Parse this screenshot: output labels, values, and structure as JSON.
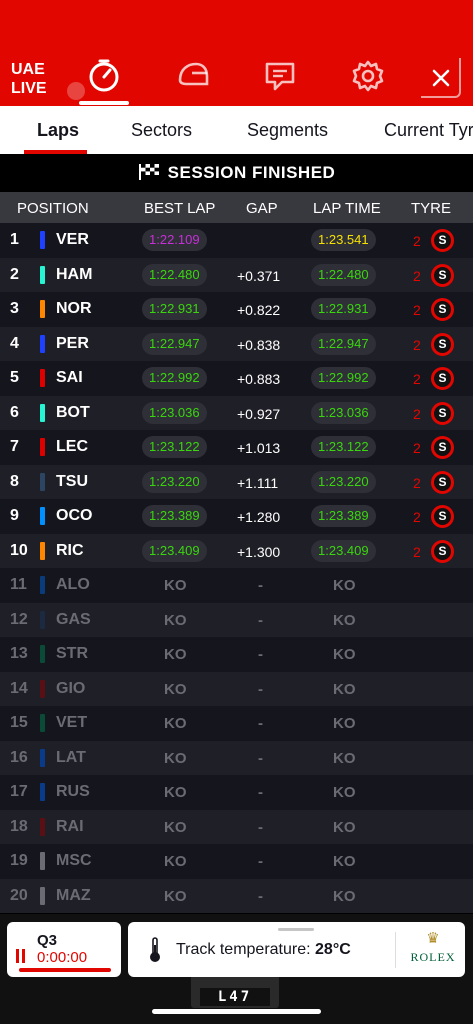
{
  "header": {
    "event_code": "UAE",
    "live_label": "LIVE",
    "icons": [
      "timing-icon",
      "driver-helmet-icon",
      "race-control-messages-icon",
      "settings-icon",
      "close-icon"
    ]
  },
  "tabs": [
    {
      "label": "Laps",
      "active": true
    },
    {
      "label": "Sectors",
      "active": false
    },
    {
      "label": "Segments",
      "active": false
    },
    {
      "label": "Current Tyres",
      "active": false
    }
  ],
  "session": {
    "status": "SESSION FINISHED"
  },
  "columns": {
    "position": "POSITION",
    "best_lap": "BEST LAP",
    "gap": "GAP",
    "lap_time": "LAP TIME",
    "tyre": "TYRE"
  },
  "rows": [
    {
      "pos": "1",
      "driver": "VER",
      "team_color": "#1e41ff",
      "best": "1:22.109",
      "best_color": "purple",
      "gap": "",
      "last": "1:23.541",
      "last_color": "yellow",
      "tyre_age": "2",
      "tyre": "S"
    },
    {
      "pos": "2",
      "driver": "HAM",
      "team_color": "#27f4d2",
      "best": "1:22.480",
      "best_color": "green",
      "gap": "+0.371",
      "last": "1:22.480",
      "last_color": "green",
      "tyre_age": "2",
      "tyre": "S"
    },
    {
      "pos": "3",
      "driver": "NOR",
      "team_color": "#ff8700",
      "best": "1:22.931",
      "best_color": "green",
      "gap": "+0.822",
      "last": "1:22.931",
      "last_color": "green",
      "tyre_age": "2",
      "tyre": "S"
    },
    {
      "pos": "4",
      "driver": "PER",
      "team_color": "#1e41ff",
      "best": "1:22.947",
      "best_color": "green",
      "gap": "+0.838",
      "last": "1:22.947",
      "last_color": "green",
      "tyre_age": "2",
      "tyre": "S"
    },
    {
      "pos": "5",
      "driver": "SAI",
      "team_color": "#dc0000",
      "best": "1:22.992",
      "best_color": "green",
      "gap": "+0.883",
      "last": "1:22.992",
      "last_color": "green",
      "tyre_age": "2",
      "tyre": "S"
    },
    {
      "pos": "6",
      "driver": "BOT",
      "team_color": "#27f4d2",
      "best": "1:23.036",
      "best_color": "green",
      "gap": "+0.927",
      "last": "1:23.036",
      "last_color": "green",
      "tyre_age": "2",
      "tyre": "S"
    },
    {
      "pos": "7",
      "driver": "LEC",
      "team_color": "#dc0000",
      "best": "1:23.122",
      "best_color": "green",
      "gap": "+1.013",
      "last": "1:23.122",
      "last_color": "green",
      "tyre_age": "2",
      "tyre": "S"
    },
    {
      "pos": "8",
      "driver": "TSU",
      "team_color": "#2b4562",
      "best": "1:23.220",
      "best_color": "green",
      "gap": "+1.111",
      "last": "1:23.220",
      "last_color": "green",
      "tyre_age": "2",
      "tyre": "S"
    },
    {
      "pos": "9",
      "driver": "OCO",
      "team_color": "#0090ff",
      "best": "1:23.389",
      "best_color": "green",
      "gap": "+1.280",
      "last": "1:23.389",
      "last_color": "green",
      "tyre_age": "2",
      "tyre": "S"
    },
    {
      "pos": "10",
      "driver": "RIC",
      "team_color": "#ff8700",
      "best": "1:23.409",
      "best_color": "green",
      "gap": "+1.300",
      "last": "1:23.409",
      "last_color": "green",
      "tyre_age": "2",
      "tyre": "S"
    },
    {
      "pos": "11",
      "driver": "ALO",
      "team_color": "#0a3b7a",
      "ko": true,
      "best": "KO",
      "gap": "-",
      "last": "KO"
    },
    {
      "pos": "12",
      "driver": "GAS",
      "team_color": "#1b2a40",
      "ko": true,
      "best": "KO",
      "gap": "-",
      "last": "KO"
    },
    {
      "pos": "13",
      "driver": "STR",
      "team_color": "#0b4a36",
      "ko": true,
      "best": "KO",
      "gap": "-",
      "last": "KO"
    },
    {
      "pos": "14",
      "driver": "GIO",
      "team_color": "#5a0f14",
      "ko": true,
      "best": "KO",
      "gap": "-",
      "last": "KO"
    },
    {
      "pos": "15",
      "driver": "VET",
      "team_color": "#0b4a36",
      "ko": true,
      "best": "KO",
      "gap": "-",
      "last": "KO"
    },
    {
      "pos": "16",
      "driver": "LAT",
      "team_color": "#0a3b8a",
      "ko": true,
      "best": "KO",
      "gap": "-",
      "last": "KO"
    },
    {
      "pos": "17",
      "driver": "RUS",
      "team_color": "#0a3b8a",
      "ko": true,
      "best": "KO",
      "gap": "-",
      "last": "KO"
    },
    {
      "pos": "18",
      "driver": "RAI",
      "team_color": "#5a0f14",
      "ko": true,
      "best": "KO",
      "gap": "-",
      "last": "KO"
    },
    {
      "pos": "19",
      "driver": "MSC",
      "team_color": "#6b6b73",
      "ko": true,
      "best": "KO",
      "gap": "-",
      "last": "KO"
    },
    {
      "pos": "20",
      "driver": "MAZ",
      "team_color": "#6b6b73",
      "ko": true,
      "best": "KO",
      "gap": "-",
      "last": "KO"
    }
  ],
  "footer": {
    "session_label": "Q3",
    "session_clock": "0:00:00",
    "temp_label": "Track temperature:",
    "temp_value": "28°C",
    "sponsor": "ROLEX",
    "lap_board": "L47"
  },
  "colors": {
    "accent": "#e10600",
    "personal_best": "#39d60e",
    "overall_best": "#c72fd9",
    "latest": "#f5e100"
  }
}
